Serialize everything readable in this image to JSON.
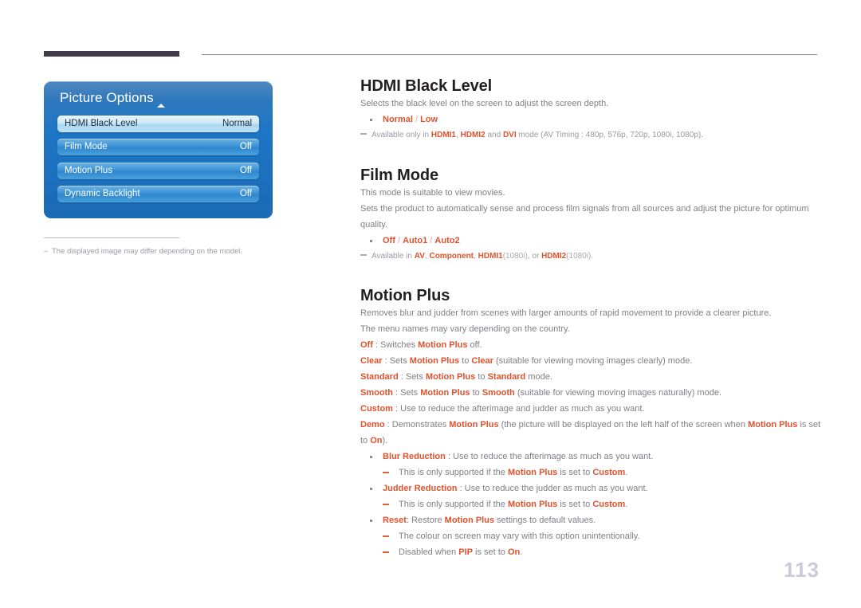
{
  "page": {
    "number": "113"
  },
  "figure": {
    "osd": {
      "title": "Picture Options",
      "caret_icon": "caret-up-icon",
      "rows": [
        {
          "label": "HDMI Black Level",
          "value": "Normal",
          "selected": true
        },
        {
          "label": "Film Mode",
          "value": "Off",
          "selected": false
        },
        {
          "label": "Motion Plus",
          "value": "Off",
          "selected": false
        },
        {
          "label": "Dynamic Backlight",
          "value": "Off",
          "selected": false
        }
      ]
    },
    "note": "The displayed image may differ depending on the model."
  },
  "sections": {
    "hdmi_black_level": {
      "title": "HDMI Black Level",
      "description": "Selects the black level on the screen to adjust the screen depth.",
      "options": {
        "first": "Normal",
        "sep": " / ",
        "second": "Low"
      },
      "note": {
        "p1": "Available only in ",
        "b1": "HDMI1",
        "p2": ", ",
        "b2": "HDMI2",
        "p3": " and ",
        "b3": "DVI",
        "p4": " mode (AV Timing : 480p, 576p, 720p, 1080i, 1080p)."
      }
    },
    "film_mode": {
      "title": "Film Mode",
      "description1": "This mode is suitable to view movies.",
      "description2": "Sets the product to automatically sense and process film signals from all sources and adjust the picture for optimum quality.",
      "options": {
        "o1": "Off",
        "s1": " / ",
        "o2": "Auto1",
        "s2": " / ",
        "o3": "Auto2"
      },
      "note": {
        "p1": "Available in ",
        "b1": "AV",
        "p2": ", ",
        "b2": "Component",
        "p3": ", ",
        "b3": "HDMI1",
        "p4": "(1080i)",
        "p5": ", or ",
        "b4": "HDMI2",
        "p6": "(1080i)."
      }
    },
    "motion_plus": {
      "title": "Motion Plus",
      "description1": "Removes blur and judder from scenes with larger amounts of rapid movement to provide a clearer picture.",
      "description2": "The menu names may vary depending on the country.",
      "modes": {
        "off": {
          "key": "Off",
          "sep": " : Switches ",
          "ref": "Motion Plus",
          "tail": " off."
        },
        "clear": {
          "key": "Clear",
          "sep": " : Sets ",
          "ref": "Motion Plus",
          "mid": " to ",
          "val": "Clear",
          "tail": " (suitable for viewing moving images clearly) mode."
        },
        "standard": {
          "key": "Standard",
          "sep": " : Sets ",
          "ref": "Motion Plus",
          "mid": " to ",
          "val": "Standard",
          "tail": " mode."
        },
        "smooth": {
          "key": "Smooth",
          "sep": " : Sets ",
          "ref": "Motion Plus",
          "mid": " to ",
          "val": "Smooth",
          "tail": " (suitable for viewing moving images naturally) mode."
        },
        "custom": {
          "key": "Custom",
          "sep": " : Use to reduce the afterimage and judder as much as you want."
        },
        "demo": {
          "key": "Demo",
          "sep": " : Demonstrates ",
          "ref": "Motion Plus",
          "mid": " (the picture will be displayed on the left half of the screen when ",
          "ref2": "Motion Plus",
          "mid2": " is set to ",
          "val": "On",
          "tail": ")."
        }
      },
      "sub_items": {
        "blur_reduction": {
          "key": "Blur Reduction",
          "text": " : Use to reduce the afterimage as much as you want.",
          "note": {
            "p1": "This is only supported if the ",
            "b1": "Motion Plus",
            "p2": " is set to ",
            "b2": "Custom",
            "p3": "."
          }
        },
        "judder_reduction": {
          "key": "Judder Reduction",
          "text": " : Use to reduce the judder as much as you want.",
          "note": {
            "p1": "This is only supported if the ",
            "b1": "Motion Plus",
            "p2": " is set to ",
            "b2": "Custom",
            "p3": "."
          }
        },
        "reset": {
          "key": "Reset",
          "text1": ": Restore ",
          "ref": "Motion Plus",
          "text2": " settings to default values.",
          "note1": "The colour on screen may vary with this option unintentionally.",
          "note2": {
            "p1": "Disabled when ",
            "b1": "PIP",
            "p2": " is set to ",
            "b2": "On",
            "p3": "."
          }
        }
      }
    }
  },
  "colors": {
    "accent_orange": "#e1522c",
    "heading_dark": "#231f20",
    "body_gray": "#7f7f86",
    "osd_blue": "#1f76c4",
    "page_number": "#c9cbdb"
  }
}
